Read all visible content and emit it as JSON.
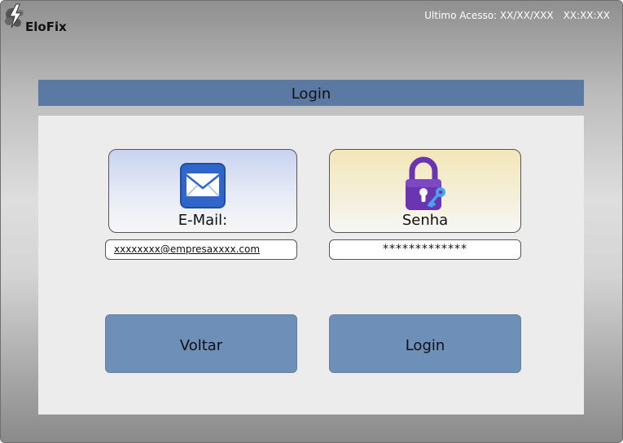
{
  "header": {
    "brand": "EloFix",
    "last_access_label": "Ultimo Acesso: XX/XX/XXX",
    "last_access_time": "XX:XX:XX"
  },
  "login_panel": {
    "title": "Login",
    "email_card": {
      "label": "E-Mail:",
      "icon": "envelope-icon"
    },
    "password_card": {
      "label": "Senha",
      "icon": "padlock-key-icon"
    },
    "email_value": "xxxxxxxx@empresaxxxx.com",
    "password_value": "*************",
    "back_button": "Voltar",
    "login_button": "Login"
  },
  "colors": {
    "title_bar": "#5a7aa4",
    "button": "#6e8fb8",
    "panel": "#ececec",
    "envelope": "#2f66c9",
    "padlock": "#6a35b0",
    "key": "#4aa3f0"
  }
}
